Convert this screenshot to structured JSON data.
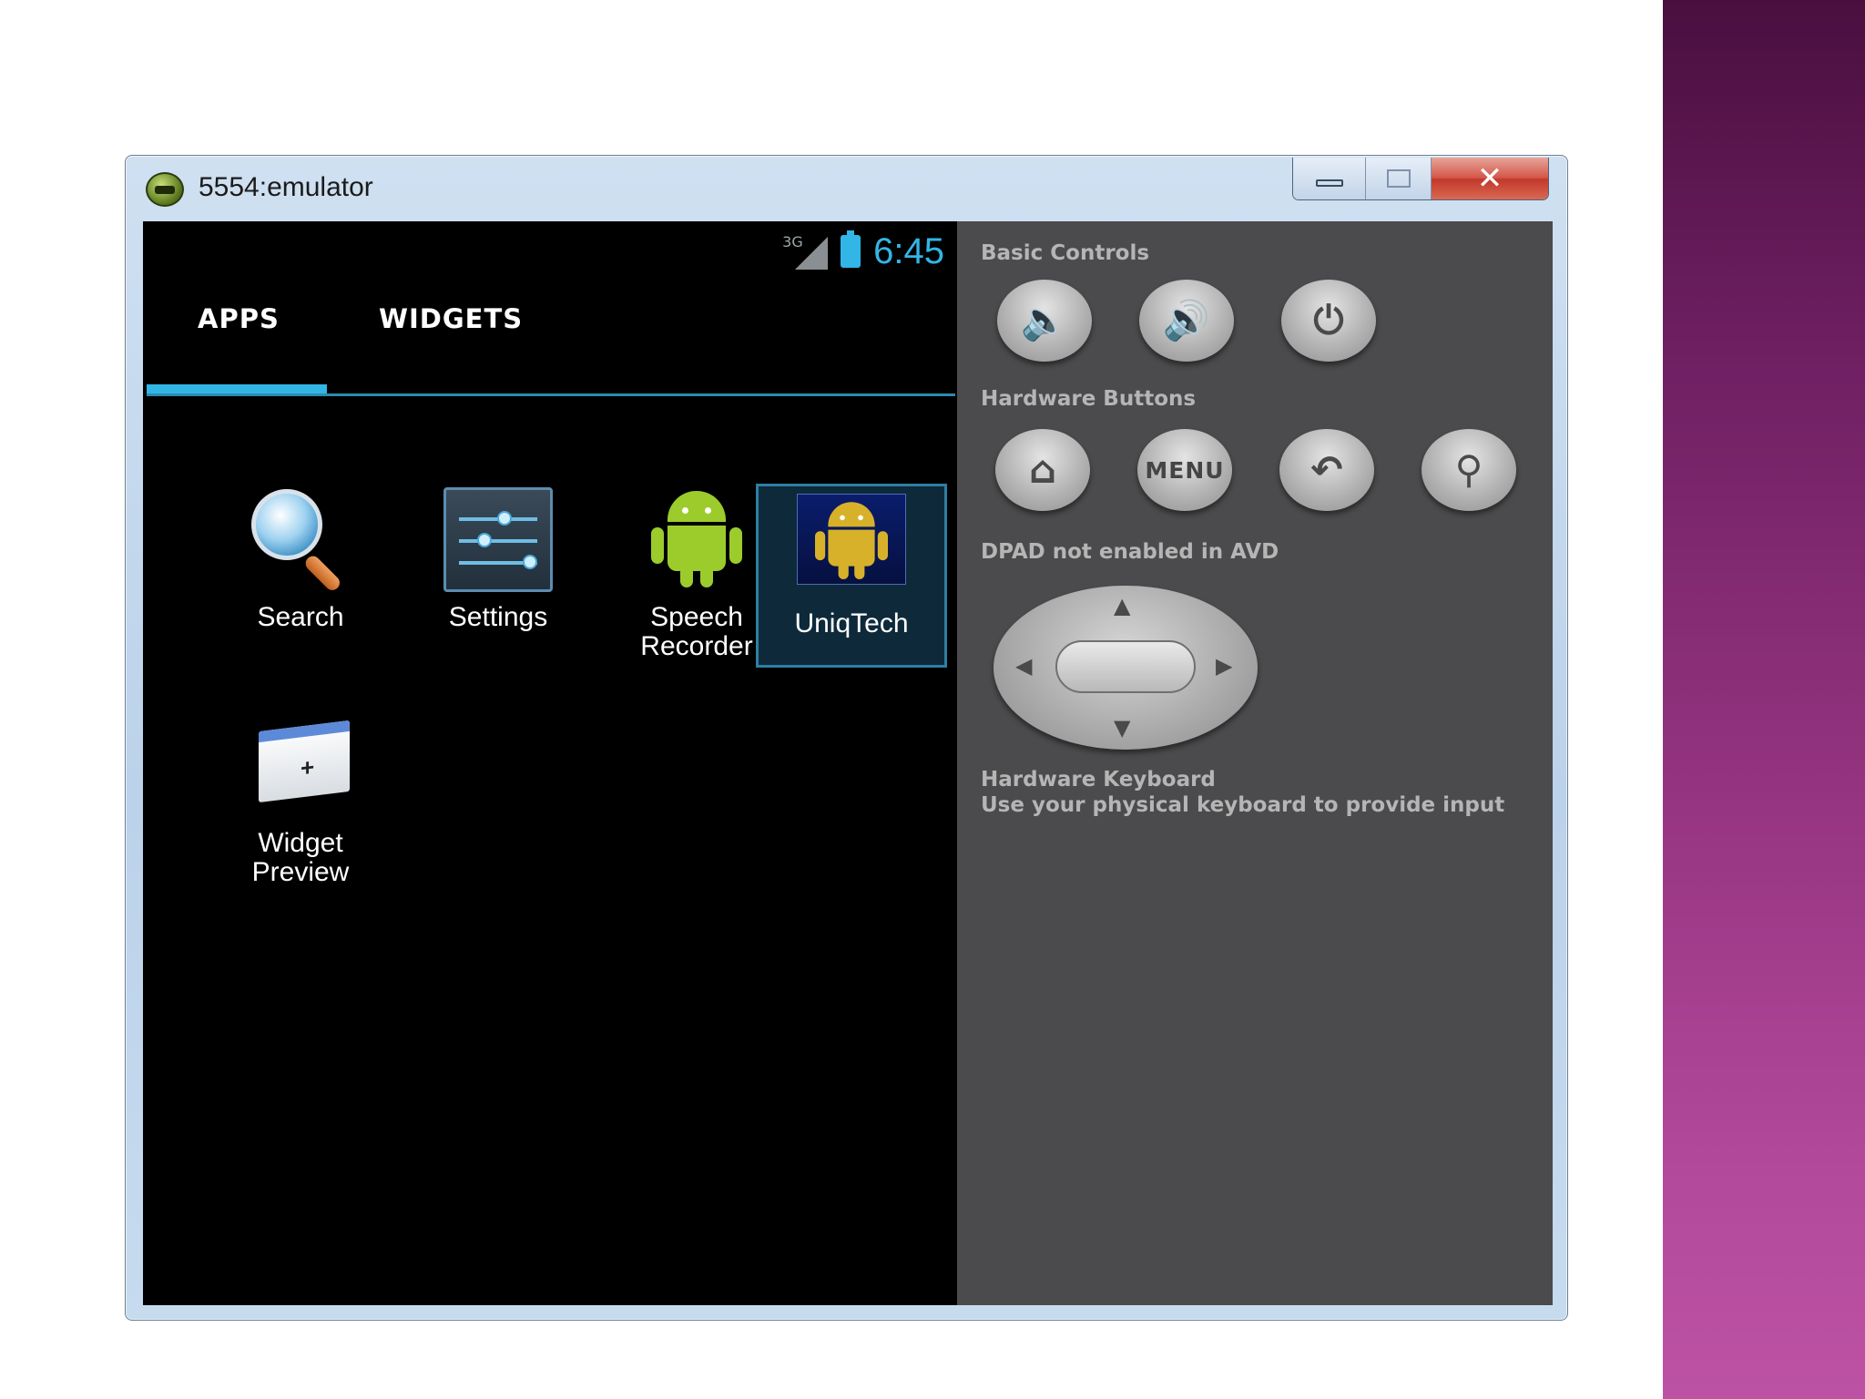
{
  "window": {
    "title": "5554:emulator",
    "buttons": {
      "minimize": "minimize",
      "maximize": "maximize",
      "close": "✕"
    }
  },
  "statusbar": {
    "network": "3G",
    "time": "6:45"
  },
  "tabs": [
    {
      "label": "APPS",
      "selected": true
    },
    {
      "label": "WIDGETS",
      "selected": false
    }
  ],
  "apps": [
    {
      "label_line1": "Search",
      "label_line2": "",
      "icon": "search-icon"
    },
    {
      "label_line1": "Settings",
      "label_line2": "",
      "icon": "settings-icon"
    },
    {
      "label_line1": "Speech",
      "label_line2": "Recorder",
      "icon": "android-icon"
    },
    {
      "label_line1": "UniqTech",
      "label_line2": "",
      "icon": "android-gold-icon",
      "selected": true
    },
    {
      "label_line1": "Widget",
      "label_line2": "Preview",
      "icon": "widget-preview-icon"
    }
  ],
  "controls": {
    "basic_label": "Basic Controls",
    "hardware_label": "Hardware Buttons",
    "menu_label": "MENU",
    "dpad_label": "DPAD not enabled in AVD",
    "keyboard_label": "Hardware Keyboard",
    "keyboard_sub": "Use your physical keyboard to provide input",
    "basic_buttons": [
      "volume-down-icon",
      "volume-up-icon",
      "power-icon"
    ],
    "hardware_buttons": [
      "home-icon",
      "menu-button",
      "back-icon",
      "search-icon"
    ]
  },
  "colors": {
    "accent": "#33b5e5",
    "panel": "#4b4a4c",
    "screen": "#000000",
    "band": "#93337f"
  }
}
